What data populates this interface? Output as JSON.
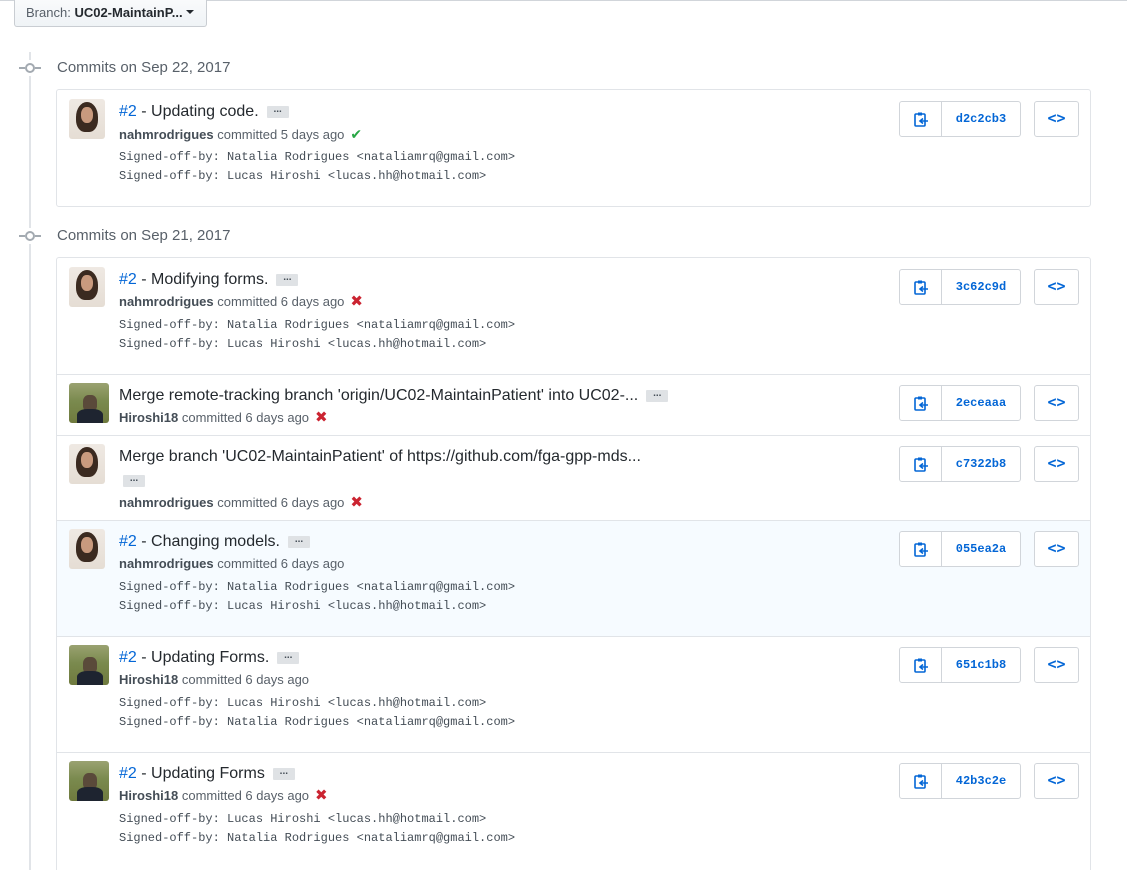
{
  "branch": {
    "label": "Branch:",
    "value": "UC02-MaintainP..."
  },
  "groups": [
    {
      "title": "Commits on Sep 22, 2017",
      "commits": [
        {
          "issue": "#2",
          "title": " - Updating code.",
          "author": "nahmrodrigues",
          "when": " committed 5 days ago",
          "status": "success",
          "status_glyph": "✔",
          "body": [
            "Signed-off-by: Natalia Rodrigues <nataliamrq@gmail.com>",
            "Signed-off-by: Lucas Hiroshi <lucas.hh@hotmail.com>"
          ],
          "sha": "d2c2cb3",
          "avatar": "avatar-natalia"
        }
      ]
    },
    {
      "title": "Commits on Sep 21, 2017",
      "commits": [
        {
          "issue": "#2",
          "title": " - Modifying forms.",
          "author": "nahmrodrigues",
          "when": " committed 6 days ago",
          "status": "failure",
          "status_glyph": "✖",
          "body": [
            "Signed-off-by: Natalia Rodrigues <nataliamrq@gmail.com>",
            "Signed-off-by: Lucas Hiroshi <lucas.hh@hotmail.com>"
          ],
          "sha": "3c62c9d",
          "avatar": "avatar-natalia"
        },
        {
          "issue": "",
          "title": "Merge remote-tracking branch 'origin/UC02-MaintainPatient' into UC02-...",
          "author": "Hiroshi18",
          "when": " committed 6 days ago",
          "status": "failure",
          "status_glyph": "✖",
          "body": [],
          "sha": "2eceaaa",
          "avatar": "avatar-hiroshi"
        },
        {
          "issue": "",
          "title": "Merge branch 'UC02-MaintainPatient' of https://github.com/fga-gpp-mds...",
          "author": "nahmrodrigues",
          "when": " committed 6 days ago",
          "status": "failure",
          "status_glyph": "✖",
          "body": [],
          "sha": "c7322b8",
          "avatar": "avatar-natalia"
        },
        {
          "issue": "#2",
          "title": " - Changing models.",
          "author": "nahmrodrigues",
          "when": " committed 6 days ago",
          "status": "none",
          "status_glyph": "",
          "body": [
            "Signed-off-by: Natalia Rodrigues <nataliamrq@gmail.com>",
            "Signed-off-by: Lucas Hiroshi <lucas.hh@hotmail.com>"
          ],
          "sha": "055ea2a",
          "avatar": "avatar-natalia"
        },
        {
          "issue": "#2",
          "title": " - Updating Forms.",
          "author": "Hiroshi18",
          "when": " committed 6 days ago",
          "status": "none",
          "status_glyph": "",
          "body": [
            "Signed-off-by: Lucas Hiroshi <lucas.hh@hotmail.com>",
            "Signed-off-by: Natalia Rodrigues <nataliamrq@gmail.com>"
          ],
          "sha": "651c1b8",
          "avatar": "avatar-hiroshi"
        },
        {
          "issue": "#2",
          "title": " - Updating Forms",
          "author": "Hiroshi18",
          "when": " committed 6 days ago",
          "status": "failure",
          "status_glyph": "✖",
          "body": [
            "Signed-off-by: Lucas Hiroshi <lucas.hh@hotmail.com>",
            "Signed-off-by: Natalia Rodrigues <nataliamrq@gmail.com>"
          ],
          "sha": "42b3c2e",
          "avatar": "avatar-hiroshi"
        }
      ]
    }
  ],
  "ellipsis_label": "...",
  "browse_glyph": "<>",
  "icons": {
    "copy": "clippy-icon",
    "browse": "code-icon"
  },
  "colors": {
    "link": "#0366d6",
    "success": "#28a745",
    "failure": "#cb2431",
    "highlight": "#f6fbff"
  }
}
